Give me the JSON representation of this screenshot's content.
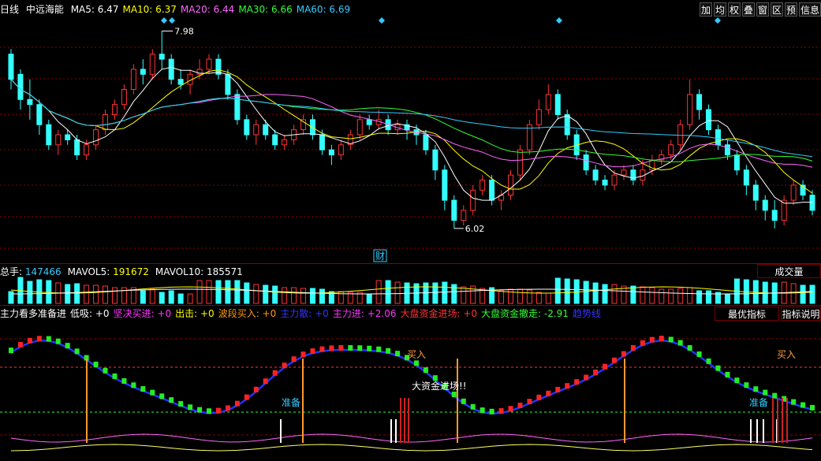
{
  "price_header": {
    "period": "日线",
    "name": "中远海能",
    "ma": [
      {
        "label": "MA5: 6.47",
        "color": "#ffffff"
      },
      {
        "label": "MA10: 6.37",
        "color": "#ffff00"
      },
      {
        "label": "MA20: 6.44",
        "color": "#ff66ff"
      },
      {
        "label": "MA30: 6.66",
        "color": "#33ff33"
      },
      {
        "label": "MA60: 6.69",
        "color": "#33ccff"
      }
    ]
  },
  "toolbar": [
    "加",
    "均",
    "权",
    "叠",
    "窗",
    "区",
    "预",
    "信息"
  ],
  "price_annotations": {
    "high": "7.98",
    "low": "6.02",
    "finance_tag": "财"
  },
  "volume_header": [
    {
      "label": "总手: ",
      "value": "147466",
      "color": "#33ccff"
    },
    {
      "label": "MAVOL5: ",
      "value": "191672",
      "color": "#ffff00"
    },
    {
      "label": "MAVOL10: ",
      "value": "185571",
      "color": "#ffffff"
    }
  ],
  "volume_button": "成交量",
  "indicator_header": [
    {
      "text": "主力看多准备进",
      "color": "#ffffff"
    },
    {
      "text": "低吸: +0",
      "color": "#ffffff"
    },
    {
      "text": "坚决买进: +0",
      "color": "#ff33ff"
    },
    {
      "text": "出击: +0",
      "color": "#ffff00"
    },
    {
      "text": "波段买入: +0",
      "color": "#ff9900"
    },
    {
      "text": "主力散: +0",
      "color": "#3333ff"
    },
    {
      "text": "主力进: +2.06",
      "color": "#ff33ff"
    },
    {
      "text": "大盘资金进场: +0",
      "color": "#ff3333"
    },
    {
      "text": "大盘资金撤走: -2.91",
      "color": "#33ff33"
    },
    {
      "text": "趋势线",
      "color": "#3333ff"
    }
  ],
  "indicator_buttons": {
    "best": "最优指标",
    "explain": "指标说明"
  },
  "indicator_labels": {
    "buy1": "买入",
    "buy2": "买入",
    "prepare1": "准备",
    "prepare2": "准备",
    "big_money": "大资金进场!!"
  },
  "colors": {
    "up": "#ff3333",
    "down": "#33ffff",
    "grid": "#8b0000"
  },
  "chart_data": {
    "type": "candlestick",
    "ylim": [
      5.8,
      8.1
    ],
    "candles": [
      [
        7.75,
        7.5,
        7.8,
        7.4
      ],
      [
        7.55,
        7.3,
        7.6,
        7.2
      ],
      [
        7.3,
        7.25,
        7.5,
        7.1
      ],
      [
        7.25,
        7.05,
        7.3,
        6.95
      ],
      [
        7.05,
        6.85,
        7.1,
        6.8
      ],
      [
        6.85,
        6.95,
        7.0,
        6.75
      ],
      [
        6.95,
        6.9,
        7.0,
        6.85
      ],
      [
        6.9,
        6.75,
        6.95,
        6.7
      ],
      [
        6.75,
        6.85,
        6.9,
        6.7
      ],
      [
        6.85,
        7.0,
        7.05,
        6.8
      ],
      [
        7.0,
        7.15,
        7.2,
        6.95
      ],
      [
        7.15,
        7.25,
        7.3,
        7.1
      ],
      [
        7.25,
        7.4,
        7.45,
        7.2
      ],
      [
        7.4,
        7.6,
        7.65,
        7.35
      ],
      [
        7.6,
        7.55,
        7.7,
        7.45
      ],
      [
        7.55,
        7.75,
        7.8,
        7.5
      ],
      [
        7.75,
        7.7,
        7.98,
        7.6
      ],
      [
        7.7,
        7.5,
        7.75,
        7.45
      ],
      [
        7.5,
        7.45,
        7.6,
        7.4
      ],
      [
        7.45,
        7.55,
        7.6,
        7.35
      ],
      [
        7.55,
        7.6,
        7.7,
        7.5
      ],
      [
        7.6,
        7.7,
        7.75,
        7.55
      ],
      [
        7.7,
        7.55,
        7.75,
        7.5
      ],
      [
        7.55,
        7.35,
        7.6,
        7.3
      ],
      [
        7.35,
        7.1,
        7.4,
        7.05
      ],
      [
        7.1,
        6.95,
        7.15,
        6.9
      ],
      [
        6.95,
        7.05,
        7.1,
        6.85
      ],
      [
        7.05,
        6.95,
        7.1,
        6.9
      ],
      [
        6.95,
        6.85,
        7.0,
        6.8
      ],
      [
        6.85,
        6.9,
        6.95,
        6.8
      ],
      [
        6.9,
        7.0,
        7.05,
        6.85
      ],
      [
        7.0,
        7.1,
        7.15,
        6.95
      ],
      [
        7.1,
        6.95,
        7.15,
        6.9
      ],
      [
        6.95,
        6.8,
        7.0,
        6.75
      ],
      [
        6.8,
        6.75,
        6.85,
        6.65
      ],
      [
        6.75,
        6.85,
        6.9,
        6.7
      ],
      [
        6.85,
        6.95,
        7.0,
        6.8
      ],
      [
        6.95,
        7.1,
        7.15,
        6.9
      ],
      [
        7.1,
        7.05,
        7.15,
        7.0
      ],
      [
        7.05,
        7.1,
        7.2,
        7.0
      ],
      [
        7.1,
        7.0,
        7.15,
        6.95
      ],
      [
        7.0,
        7.05,
        7.1,
        6.95
      ],
      [
        7.05,
        7.0,
        7.1,
        6.9
      ],
      [
        7.0,
        6.95,
        7.05,
        6.85
      ],
      [
        6.95,
        6.8,
        7.0,
        6.75
      ],
      [
        6.8,
        6.6,
        6.85,
        6.5
      ],
      [
        6.6,
        6.3,
        6.65,
        6.2
      ],
      [
        6.3,
        6.1,
        6.35,
        6.02
      ],
      [
        6.1,
        6.2,
        6.25,
        6.05
      ],
      [
        6.2,
        6.4,
        6.45,
        6.15
      ],
      [
        6.4,
        6.5,
        6.55,
        6.35
      ],
      [
        6.5,
        6.3,
        6.55,
        6.25
      ],
      [
        6.3,
        6.35,
        6.4,
        6.2
      ],
      [
        6.35,
        6.55,
        6.6,
        6.3
      ],
      [
        6.55,
        6.8,
        6.85,
        6.5
      ],
      [
        6.8,
        7.05,
        7.1,
        6.75
      ],
      [
        7.05,
        7.2,
        7.3,
        7.0
      ],
      [
        7.2,
        7.35,
        7.45,
        7.15
      ],
      [
        7.35,
        7.15,
        7.4,
        7.1
      ],
      [
        7.15,
        6.95,
        7.2,
        6.9
      ],
      [
        6.95,
        6.75,
        7.0,
        6.7
      ],
      [
        6.75,
        6.6,
        6.8,
        6.55
      ],
      [
        6.6,
        6.5,
        6.65,
        6.45
      ],
      [
        6.5,
        6.45,
        6.55,
        6.4
      ],
      [
        6.45,
        6.55,
        6.6,
        6.4
      ],
      [
        6.55,
        6.6,
        6.65,
        6.5
      ],
      [
        6.6,
        6.5,
        6.65,
        6.45
      ],
      [
        6.5,
        6.6,
        6.7,
        6.45
      ],
      [
        6.6,
        6.7,
        6.75,
        6.55
      ],
      [
        6.7,
        6.75,
        6.8,
        6.65
      ],
      [
        6.75,
        6.85,
        6.9,
        6.7
      ],
      [
        6.85,
        7.05,
        7.1,
        6.8
      ],
      [
        7.05,
        7.35,
        7.5,
        7.0
      ],
      [
        7.35,
        7.2,
        7.4,
        7.1
      ],
      [
        7.2,
        7.0,
        7.25,
        6.95
      ],
      [
        7.0,
        6.85,
        7.05,
        6.8
      ],
      [
        6.85,
        6.75,
        6.9,
        6.7
      ],
      [
        6.75,
        6.6,
        6.8,
        6.55
      ],
      [
        6.6,
        6.45,
        6.65,
        6.35
      ],
      [
        6.45,
        6.3,
        6.5,
        6.2
      ],
      [
        6.3,
        6.2,
        6.35,
        6.1
      ],
      [
        6.2,
        6.1,
        6.3,
        6.02
      ],
      [
        6.1,
        6.3,
        6.35,
        6.05
      ],
      [
        6.3,
        6.45,
        6.5,
        6.25
      ],
      [
        6.45,
        6.35,
        6.5,
        6.3
      ],
      [
        6.35,
        6.2,
        6.4,
        6.15
      ]
    ]
  }
}
